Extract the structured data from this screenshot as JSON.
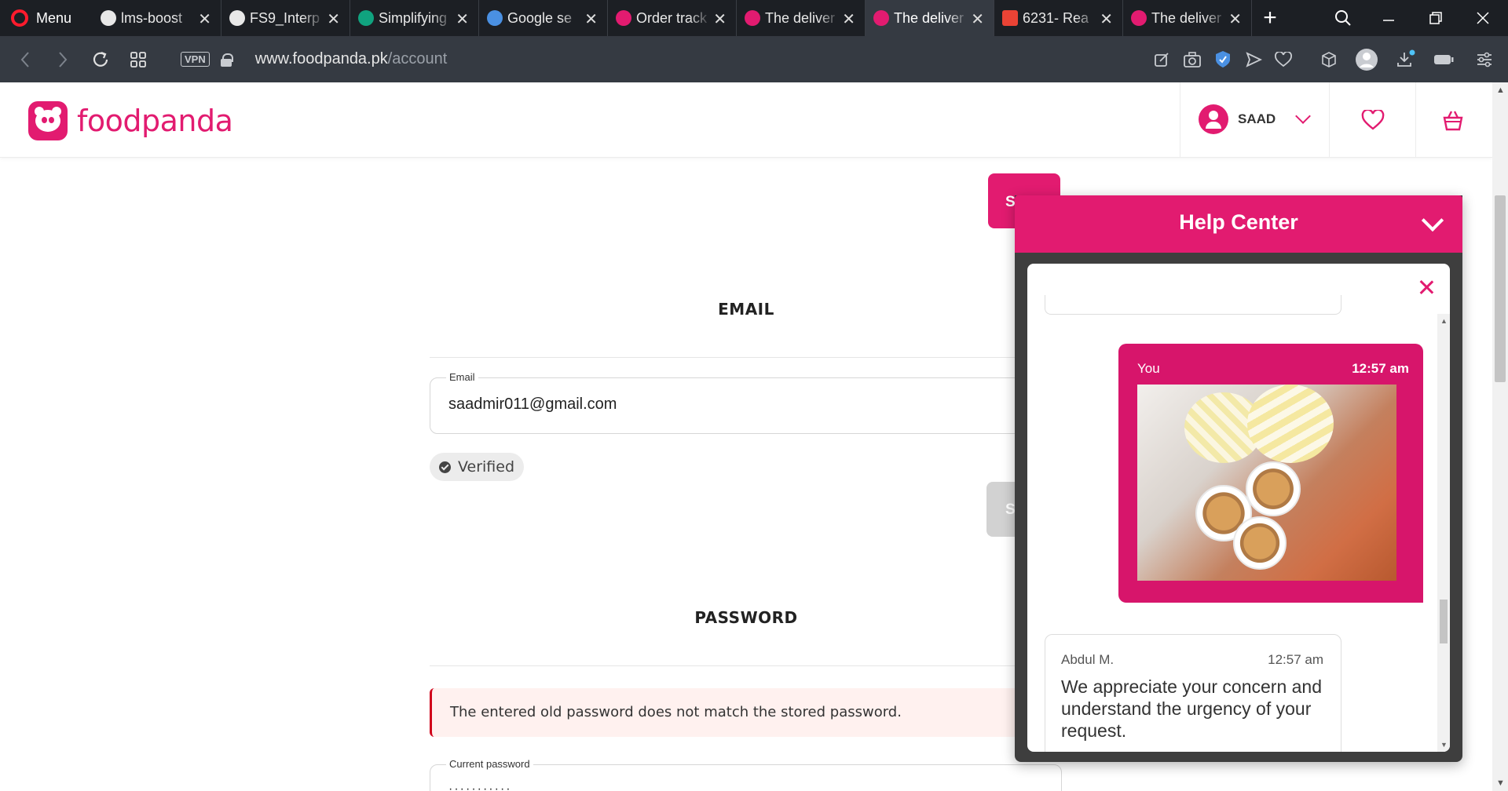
{
  "browser": {
    "menu_label": "Menu",
    "tabs": [
      {
        "title": "lms-boost",
        "favicon_color": "#e8e8e8"
      },
      {
        "title": "FS9_Interp",
        "favicon_color": "#e8e8e8"
      },
      {
        "title": "Simplifying",
        "favicon_color": "#10a37f"
      },
      {
        "title": "Google se",
        "favicon_color": "#4a90e2"
      },
      {
        "title": "Order track",
        "favicon_color": "#e21b70"
      },
      {
        "title": "The deliver",
        "favicon_color": "#e21b70"
      },
      {
        "title": "The deliver",
        "favicon_color": "#e21b70"
      },
      {
        "title": "6231- Rea",
        "favicon_color": "#ea4335"
      },
      {
        "title": "The deliver",
        "favicon_color": "#e21b70"
      }
    ],
    "active_tab_index": 6,
    "vpn_label": "VPN",
    "url_host": "www.foodpanda.pk",
    "url_path": "/account"
  },
  "site": {
    "brand": "foodpanda",
    "brand_color": "#e21b70",
    "user_name": "SAAD"
  },
  "account": {
    "email_section_title": "EMAIL",
    "email_label": "Email",
    "email_value": "saadmir011@gmail.com",
    "verified_label": "Verified",
    "password_section_title": "PASSWORD",
    "error_message": "The entered old password does not match the stored password.",
    "current_password_label": "Current password",
    "current_password_mask": "···········"
  },
  "help_center": {
    "title": "Help Center",
    "messages": [
      {
        "sender": "You",
        "time": "12:57 am",
        "type": "image"
      },
      {
        "sender": "Abdul M.",
        "time": "12:57 am",
        "text": "We appreciate your concern and understand the urgency of your request."
      }
    ]
  }
}
